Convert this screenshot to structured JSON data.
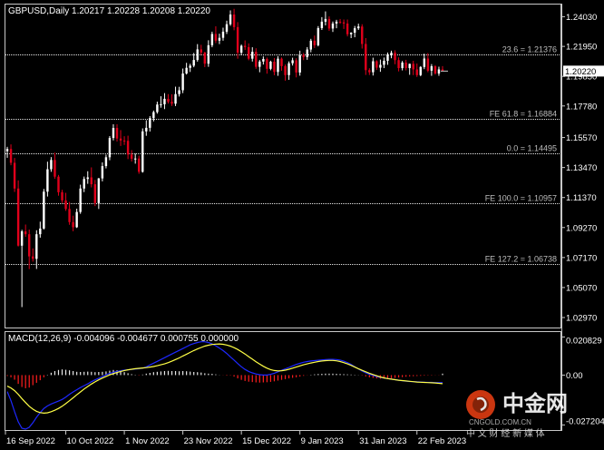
{
  "app": {
    "symbol_header": "GBPUSD,Daily  1.20217 1.20228 1.20208 1.20220",
    "watermark_brand": "中金网",
    "watermark_sub": "CNGOLD.COM.CN",
    "watermark_slogan": "中 文 财 经 新 媒 体"
  },
  "colors": {
    "background": "#000000",
    "frame": "#c8c8c8",
    "bull_candle": "#ffffff",
    "bear_candle": "#e0001b",
    "fib_line": "#e8e8e8",
    "macd_hist": "#e8e8e8",
    "macd_hist_neg": "#ff1e1e",
    "macd_line": "#1e28ff",
    "signal_line": "#ffff46",
    "text": "#ffffff",
    "label": "#bdbdbd",
    "price_tag_bg": "#ffffff",
    "price_tag_fg": "#000000"
  },
  "chart_data": [
    {
      "type": "candlestick",
      "title": "GBPUSD,Daily",
      "ohlc_header": [
        "1.20217",
        "1.20228",
        "1.20208",
        "1.20220"
      ],
      "current_price_label": "1.20220",
      "y_ticks": [
        "1.24030",
        "1.21950",
        "1.19850",
        "1.17780",
        "1.15570",
        "1.13470",
        "1.11370",
        "1.09270",
        "1.07170",
        "1.05070",
        "1.02970"
      ],
      "ylim": [
        1.0227,
        1.2488
      ],
      "x_tick_labels": [
        "16 Sep 2022",
        "10 Oct 2022",
        "1 Nov 2022",
        "23 Nov 2022",
        "15 Dec 2022",
        "9 Jan 2023",
        "31 Jan 2023",
        "22 Feb 2023"
      ],
      "x_tick_bar_index": [
        0,
        16,
        32,
        48,
        64,
        80,
        96,
        112
      ],
      "levels": [
        {
          "label": "23.6 = 1.21376",
          "value": 1.21376
        },
        {
          "label": "FE 61.8 = 1.16884",
          "value": 1.16884
        },
        {
          "label": "0.0 = 1.14495",
          "value": 1.14495
        },
        {
          "label": "FE 100.0 = 1.10957",
          "value": 1.10957
        },
        {
          "label": "FE 127.2 = 1.06738",
          "value": 1.06738
        }
      ],
      "series": {
        "open": [
          1.1461,
          1.1477,
          1.138,
          1.12,
          1.08,
          1.09,
          1.088,
          1.0725,
          1.0708,
          1.088,
          1.092,
          1.1178,
          1.1335,
          1.14,
          1.1283,
          1.1174,
          1.1117,
          1.1057,
          1.0965,
          1.0929,
          1.1036,
          1.12,
          1.1267,
          1.1278,
          1.123,
          1.1098,
          1.1271,
          1.1357,
          1.1419,
          1.1554,
          1.1624,
          1.155,
          1.1536,
          1.1534,
          1.1438,
          1.1408,
          1.141,
          1.1317,
          1.16,
          1.1625,
          1.1693,
          1.1735,
          1.1788,
          1.179,
          1.1828,
          1.1807,
          1.1794,
          1.1861,
          1.1888,
          1.2005,
          1.2045,
          1.206,
          1.21,
          1.2174,
          1.2152,
          1.2074,
          1.2203,
          1.2282,
          1.2235,
          1.2255,
          1.2298,
          1.235,
          1.2418,
          1.233,
          1.2151,
          1.2199,
          1.219,
          1.2109,
          1.2157,
          1.2052,
          1.2089,
          1.2107,
          1.2038,
          1.2088,
          1.2016,
          1.2109,
          1.2057,
          1.1994,
          1.2077,
          1.2098,
          1.2012,
          1.2135,
          1.212,
          1.2173,
          1.2235,
          1.2203,
          1.2323,
          1.2368,
          1.2387,
          1.232,
          1.2355,
          1.2368,
          1.2363,
          1.2355,
          1.228,
          1.2291,
          1.2322,
          1.2334,
          1.2212,
          1.2029,
          1.2014,
          1.2091,
          1.2046,
          1.2066,
          1.2094,
          1.2135,
          1.2151,
          1.2099,
          1.2043,
          1.2082,
          1.2043,
          1.2073,
          1.2034,
          1.1994,
          1.2051,
          1.211,
          1.2025,
          1.2056,
          1.2005,
          1.2034
        ],
        "high": [
          1.1492,
          1.1509,
          1.1414,
          1.1257,
          1.0911,
          1.0948,
          1.0913,
          1.0781,
          1.0908,
          1.0968,
          1.1197,
          1.1388,
          1.142,
          1.1451,
          1.1295,
          1.1191,
          1.117,
          1.1106,
          1.101,
          1.1059,
          1.1227,
          1.1284,
          1.1321,
          1.1348,
          1.126,
          1.1274,
          1.1383,
          1.1437,
          1.1567,
          1.165,
          1.165,
          1.1609,
          1.1566,
          1.157,
          1.1469,
          1.1445,
          1.143,
          1.1621,
          1.1678,
          1.1707,
          1.1746,
          1.1808,
          1.1846,
          1.1868,
          1.1861,
          1.186,
          1.1913,
          1.1912,
          1.204,
          1.208,
          1.2073,
          1.2149,
          1.2211,
          1.2206,
          1.2157,
          1.2238,
          1.2298,
          1.2336,
          1.2284,
          1.2326,
          1.2375,
          1.2447,
          1.2458,
          1.2365,
          1.2208,
          1.2237,
          1.2216,
          1.2189,
          1.2182,
          1.21,
          1.2125,
          1.2117,
          1.2095,
          1.2114,
          1.2127,
          1.2117,
          1.2068,
          1.209,
          1.2116,
          1.2112,
          1.2165,
          1.2149,
          1.219,
          1.2248,
          1.2271,
          1.2337,
          1.24,
          1.244,
          1.2405,
          1.2369,
          1.2381,
          1.2387,
          1.2383,
          1.2383,
          1.2294,
          1.2338,
          1.2354,
          1.235,
          1.2253,
          1.2042,
          1.2116,
          1.2098,
          1.2103,
          1.2117,
          1.2152,
          1.2165,
          1.2168,
          1.2118,
          1.2093,
          1.2101,
          1.2074,
          1.2094,
          1.2075,
          1.2057,
          1.2144,
          1.2148,
          1.2071,
          1.2064,
          1.2053,
          1.2057
        ],
        "low": [
          1.1415,
          1.1363,
          1.1176,
          1.0794,
          1.037,
          1.0862,
          1.0636,
          1.0688,
          1.0637,
          1.0856,
          1.0913,
          1.1144,
          1.1317,
          1.1268,
          1.115,
          1.1099,
          1.1044,
          1.0946,
          1.0901,
          1.0924,
          1.1023,
          1.1175,
          1.1233,
          1.1208,
          1.1077,
          1.1057,
          1.125,
          1.1341,
          1.1398,
          1.1537,
          1.1529,
          1.1498,
          1.1505,
          1.1406,
          1.1389,
          1.1374,
          1.1303,
          1.1311,
          1.1569,
          1.1599,
          1.167,
          1.1724,
          1.1766,
          1.1756,
          1.1795,
          1.1778,
          1.1777,
          1.1844,
          1.1868,
          1.1998,
          1.2016,
          1.2049,
          1.2088,
          1.2136,
          1.205,
          1.2052,
          1.2189,
          1.2218,
          1.2211,
          1.2235,
          1.2282,
          1.2339,
          1.2308,
          1.2109,
          1.2136,
          1.217,
          1.2098,
          1.2089,
          1.2038,
          1.2014,
          1.2068,
          1.2004,
          1.2028,
          1.1993,
          1.1989,
          1.2025,
          1.1955,
          1.1961,
          1.2061,
          1.1978,
          1.199,
          1.2099,
          1.2101,
          1.2154,
          1.2184,
          1.2195,
          1.231,
          1.2342,
          1.2304,
          1.2296,
          1.2322,
          1.2353,
          1.2317,
          1.2265,
          1.2253,
          1.2259,
          1.231,
          1.218,
          1.1995,
          1.1995,
          1.1991,
          1.203,
          1.2017,
          1.2043,
          1.2066,
          1.2112,
          1.207,
          1.202,
          1.2027,
          1.2027,
          1.1996,
          1.1994,
          1.1981,
          1.1986,
          1.2036,
          1.2014,
          1.1989,
          1.1997,
          1.1989,
          1.202
        ],
        "close": [
          1.1477,
          1.138,
          1.12,
          1.08,
          1.09,
          1.088,
          1.0725,
          1.0708,
          1.088,
          1.092,
          1.1178,
          1.1335,
          1.14,
          1.1283,
          1.1174,
          1.1117,
          1.1057,
          1.0965,
          1.0929,
          1.1036,
          1.12,
          1.1267,
          1.1278,
          1.123,
          1.1098,
          1.1271,
          1.1357,
          1.1419,
          1.1554,
          1.1624,
          1.155,
          1.1536,
          1.1534,
          1.1438,
          1.1408,
          1.141,
          1.1317,
          1.16,
          1.1625,
          1.1693,
          1.1735,
          1.1788,
          1.179,
          1.1828,
          1.1807,
          1.1794,
          1.1861,
          1.1888,
          1.2005,
          1.2045,
          1.206,
          1.21,
          1.2174,
          1.2152,
          1.2074,
          1.2203,
          1.2282,
          1.2235,
          1.2255,
          1.2298,
          1.235,
          1.2418,
          1.233,
          1.2151,
          1.2199,
          1.219,
          1.2109,
          1.2157,
          1.2052,
          1.2089,
          1.2107,
          1.2038,
          1.2088,
          1.2016,
          1.2109,
          1.2057,
          1.1994,
          1.2077,
          1.2098,
          1.2012,
          1.2135,
          1.212,
          1.2173,
          1.2235,
          1.2203,
          1.2323,
          1.2368,
          1.2387,
          1.232,
          1.2355,
          1.2368,
          1.2363,
          1.2355,
          1.228,
          1.2291,
          1.2322,
          1.2334,
          1.2212,
          1.2029,
          1.2014,
          1.2091,
          1.2046,
          1.2066,
          1.2094,
          1.2135,
          1.2151,
          1.2099,
          1.2043,
          1.2082,
          1.2043,
          1.2073,
          1.2034,
          1.1994,
          1.2051,
          1.211,
          1.2025,
          1.2056,
          1.2005,
          1.2034,
          1.2022
        ]
      }
    },
    {
      "type": "bar",
      "title": "MACD(12,26,9)",
      "header_values": [
        "-0.004096",
        "-0.004677",
        "0.000755",
        "0.000000"
      ],
      "y_ticks": [
        "0.020829",
        "0.00",
        "-0.027204"
      ],
      "ylim": [
        -0.03,
        0.0235
      ],
      "series": [
        {
          "name": "histogram",
          "values": [
            -0.0005,
            -0.0012,
            -0.0025,
            -0.0048,
            -0.0065,
            -0.0072,
            -0.0068,
            -0.0055,
            -0.0042,
            -0.0028,
            -0.0012,
            0.0002,
            0.0013,
            0.0022,
            0.0028,
            0.0031,
            0.0029,
            0.0026,
            0.0022,
            0.0018,
            0.0017,
            0.0018,
            0.0019,
            0.0018,
            0.0016,
            0.0017,
            0.0018,
            0.002,
            0.0024,
            0.0028,
            0.0026,
            0.0022,
            0.0016,
            0.001,
            0.0005,
            0.0002,
            -0.0002,
            0.0003,
            0.0008,
            0.0012,
            0.0016,
            0.0018,
            0.002,
            0.0022,
            0.0023,
            0.0022,
            0.0022,
            0.0021,
            0.0022,
            0.0021,
            0.0019,
            0.0017,
            0.0016,
            0.0014,
            0.001,
            0.0008,
            0.0007,
            0.0004,
            0.0001,
            -0.0001,
            -0.0003,
            -0.0002,
            -0.0008,
            -0.0018,
            -0.0026,
            -0.0032,
            -0.0036,
            -0.0038,
            -0.004,
            -0.0041,
            -0.004,
            -0.0039,
            -0.0037,
            -0.0034,
            -0.003,
            -0.0026,
            -0.0022,
            -0.0018,
            -0.0015,
            -0.0012,
            -0.0008,
            -0.0004,
            -0.0001,
            0.0002,
            0.0004,
            0.0006,
            0.0007,
            0.0008,
            0.0008,
            0.0008,
            0.0007,
            0.0006,
            0.0005,
            0.0004,
            0.0003,
            0.0002,
            0.0001,
            -0.0002,
            -0.0007,
            -0.0012,
            -0.0015,
            -0.0018,
            -0.002,
            -0.002,
            -0.0019,
            -0.0017,
            -0.0015,
            -0.0013,
            -0.0011,
            -0.0009,
            -0.0007,
            -0.0006,
            -0.0005,
            -0.0004,
            -0.0003,
            -0.0002,
            -0.0002,
            -0.0001,
            -0.0001,
            0.0008
          ]
        },
        {
          "name": "main",
          "values": [
            -0.009,
            -0.014,
            -0.02,
            -0.0255,
            -0.029,
            -0.0295,
            -0.0285,
            -0.026,
            -0.023,
            -0.0205,
            -0.0182,
            -0.0168,
            -0.0158,
            -0.015,
            -0.0142,
            -0.0133,
            -0.012,
            -0.0105,
            -0.0092,
            -0.008,
            -0.0068,
            -0.0058,
            -0.0048,
            -0.0036,
            -0.0026,
            -0.0017,
            -0.0008,
            0.0001,
            0.0009,
            0.0015,
            0.002,
            0.0024,
            0.0027,
            0.0029,
            0.0031,
            0.0033,
            0.0035,
            0.0038,
            0.0045,
            0.0055,
            0.0065,
            0.0075,
            0.0085,
            0.0095,
            0.0105,
            0.0115,
            0.0125,
            0.0135,
            0.0145,
            0.0155,
            0.0165,
            0.0172,
            0.0178,
            0.0182,
            0.0182,
            0.0178,
            0.017,
            0.016,
            0.0148,
            0.0134,
            0.0118,
            0.01,
            0.0082,
            0.0063,
            0.0046,
            0.0031,
            0.002,
            0.0012,
            0.0006,
            0.0002,
            0.0,
            0.0,
            0.0004,
            0.001,
            0.0018,
            0.0026,
            0.0034,
            0.0042,
            0.005,
            0.0058,
            0.0064,
            0.007,
            0.0074,
            0.0077,
            0.0079,
            0.0081,
            0.0083,
            0.0085,
            0.0086,
            0.0086,
            0.0085,
            0.0082,
            0.0076,
            0.0068,
            0.0058,
            0.0046,
            0.0034,
            0.0022,
            0.0012,
            0.0004,
            -0.0002,
            -0.0008,
            -0.0012,
            -0.0016,
            -0.0019,
            -0.0022,
            -0.0025,
            -0.0028,
            -0.0031,
            -0.0033,
            -0.0035,
            -0.0036,
            -0.0037,
            -0.0038,
            -0.0039,
            -0.004,
            -0.004,
            -0.0041,
            -0.0041,
            -0.0041
          ]
        },
        {
          "name": "signal",
          "values": [
            -0.006,
            -0.007,
            -0.0085,
            -0.0105,
            -0.0128,
            -0.015,
            -0.017,
            -0.0186,
            -0.0198,
            -0.0205,
            -0.0208,
            -0.0206,
            -0.02,
            -0.0192,
            -0.0182,
            -0.017,
            -0.0156,
            -0.014,
            -0.0124,
            -0.0108,
            -0.0092,
            -0.0076,
            -0.0062,
            -0.0049,
            -0.0037,
            -0.0026,
            -0.0016,
            -0.0007,
            0.0001,
            0.0008,
            0.0014,
            0.002,
            0.0025,
            0.0029,
            0.0032,
            0.0035,
            0.0037,
            0.0039,
            0.0041,
            0.0044,
            0.0047,
            0.0051,
            0.0056,
            0.0061,
            0.0068,
            0.0076,
            0.0085,
            0.0094,
            0.0104,
            0.0114,
            0.0124,
            0.0134,
            0.0143,
            0.0151,
            0.0158,
            0.0163,
            0.0167,
            0.0169,
            0.017,
            0.0168,
            0.0164,
            0.0158,
            0.015,
            0.014,
            0.0128,
            0.0115,
            0.0101,
            0.0087,
            0.0073,
            0.006,
            0.0048,
            0.0038,
            0.003,
            0.0025,
            0.0023,
            0.0024,
            0.0027,
            0.0032,
            0.0038,
            0.0044,
            0.005,
            0.0056,
            0.0061,
            0.0066,
            0.007,
            0.0074,
            0.0077,
            0.0079,
            0.008,
            0.008,
            0.0078,
            0.0074,
            0.0068,
            0.0061,
            0.0053,
            0.0044,
            0.0035,
            0.0026,
            0.0018,
            0.001,
            0.0003,
            -0.0004,
            -0.001,
            -0.0015,
            -0.0019,
            -0.0022,
            -0.0025,
            -0.0028,
            -0.003,
            -0.0032,
            -0.0034,
            -0.0036,
            -0.0038,
            -0.0039,
            -0.004,
            -0.0041,
            -0.0042,
            -0.0043,
            -0.0045,
            -0.0047
          ]
        }
      ]
    }
  ]
}
